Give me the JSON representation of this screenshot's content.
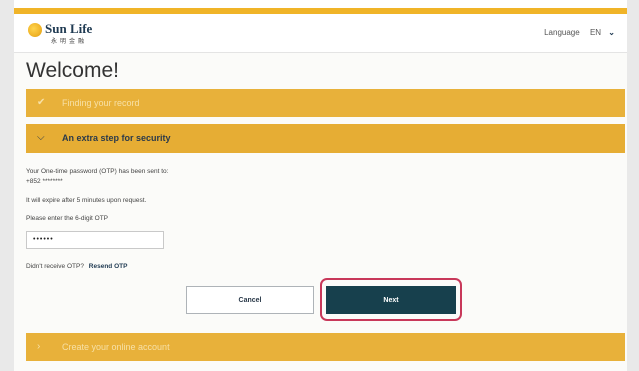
{
  "header": {
    "brand": "Sun Life",
    "brand_chinese": "永明金融",
    "language_label": "Language",
    "language_code": "EN"
  },
  "page": {
    "title": "Welcome!"
  },
  "steps": [
    {
      "label": "Finding your record",
      "status": "complete",
      "icon": "check-icon"
    },
    {
      "label": "An extra step for security",
      "status": "active",
      "icon": "chevron-down-icon"
    },
    {
      "label": "Create your online account",
      "status": "pending",
      "icon": "chevron-right-icon"
    }
  ],
  "otp": {
    "sent_to_line": "Your One-time password (OTP) has been sent to:",
    "phone": "+852 ********",
    "expiry_note": "It will expire after 5 minutes upon request.",
    "input_label": "Please enter the 6-digit OTP",
    "input_value": "••••••",
    "resend_prompt": "Didn't receive OTP?",
    "resend_link": "Resend OTP"
  },
  "actions": {
    "cancel_label": "Cancel",
    "next_label": "Next"
  },
  "colors": {
    "accent_gold": "#e8b13a",
    "dark_teal": "#17404d",
    "highlight": "#c8385a"
  }
}
